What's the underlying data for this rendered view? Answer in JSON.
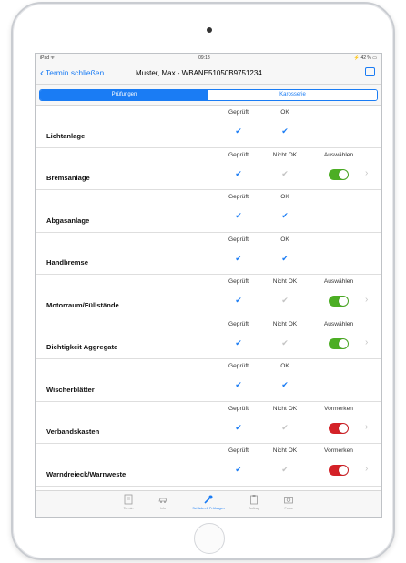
{
  "status": {
    "left": "iPad ᯤ",
    "time": "09:18",
    "right": "⚡ 42 % ▭"
  },
  "nav": {
    "back_label": "Termin schließen",
    "title": "Muster, Max - WBANE51050B9751234"
  },
  "segments": [
    {
      "label": "Prüfungen",
      "selected": true
    },
    {
      "label": "Karosserie",
      "selected": false
    }
  ],
  "rows": [
    {
      "name": "Lichtanlage",
      "c1": "Geprüft",
      "c1_check": "✔",
      "c2": "OK",
      "c2_check": "✔"
    },
    {
      "name": "Bremsanlage",
      "c1": "Geprüft",
      "c1_check": "✔",
      "c2": "Nicht OK",
      "c2_check": "✔",
      "c3": "Auswählen",
      "toggle": "on"
    },
    {
      "name": "Abgasanlage",
      "c1": "Geprüft",
      "c1_check": "✔",
      "c2": "OK",
      "c2_check": "✔"
    },
    {
      "name": "Handbremse",
      "c1": "Geprüft",
      "c1_check": "✔",
      "c2": "OK",
      "c2_check": "✔"
    },
    {
      "name": "Motorraum/Füllstände",
      "c1": "Geprüft",
      "c1_check": "✔",
      "c2": "Nicht OK",
      "c2_check": "✔",
      "c3": "Auswählen",
      "toggle": "on"
    },
    {
      "name": "Dichtigkeit Aggregate",
      "c1": "Geprüft",
      "c1_check": "✔",
      "c2": "Nicht OK",
      "c2_check": "✔",
      "c3": "Auswählen",
      "toggle": "on"
    },
    {
      "name": "Wischerblätter",
      "c1": "Geprüft",
      "c1_check": "✔",
      "c2": "OK",
      "c2_check": "✔"
    },
    {
      "name": "Verbandskasten",
      "c1": "Geprüft",
      "c1_check": "✔",
      "c2": "Nicht OK",
      "c2_check": "✔",
      "c3": "Vormerken",
      "toggle": "on"
    },
    {
      "name": "Warndreieck/Warnweste",
      "c1": "Geprüft",
      "c1_check": "✔",
      "c2": "Nicht OK",
      "c2_check": "✔",
      "c3": "Vormerken",
      "toggle": "on"
    }
  ],
  "disclosure": "›",
  "tabs": [
    {
      "label": "Termin",
      "icon": "document-icon"
    },
    {
      "label": "Info",
      "icon": "car-icon"
    },
    {
      "label": "Schäden & Prüfungen",
      "icon": "wrench-icon",
      "active": true
    },
    {
      "label": "Auftrag",
      "icon": "clipboard-icon"
    },
    {
      "label": "Fotos",
      "icon": "camera-icon"
    }
  ],
  "colors": {
    "accent": "#1a7cf4",
    "toggle_green": "#4cae24",
    "toggle_red": "#d42127",
    "check_inactive": "#c4c4c4"
  }
}
